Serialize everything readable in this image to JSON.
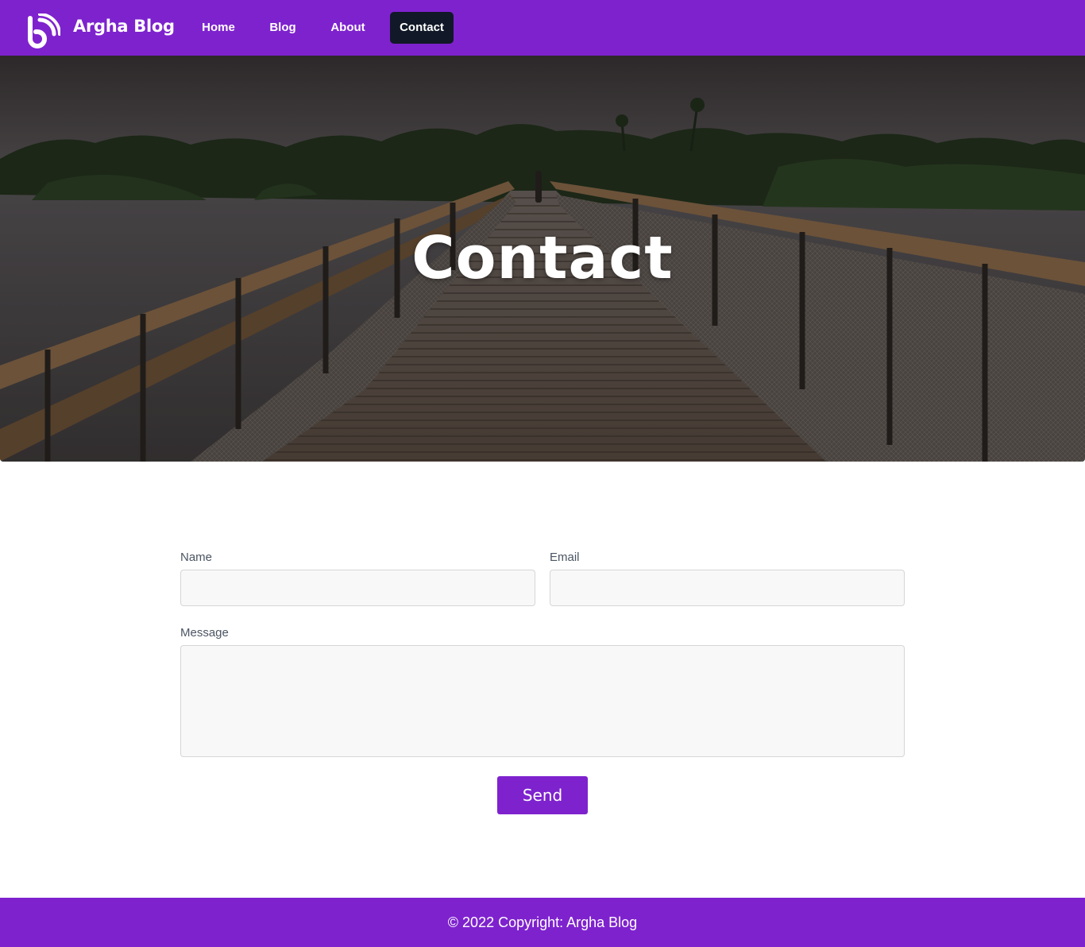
{
  "navbar": {
    "brand_name": "Argha Blog",
    "links": [
      {
        "label": "Home"
      },
      {
        "label": "Blog"
      },
      {
        "label": "About"
      },
      {
        "label": "Contact",
        "active": true
      }
    ],
    "background_color": "#7e22ce",
    "active_link_color": "#111827"
  },
  "hero": {
    "title": "Contact",
    "image": "bridge-boardwalk-photo"
  },
  "form": {
    "name_label": "Name",
    "name_value": "",
    "email_label": "Email",
    "email_value": "",
    "message_label": "Message",
    "message_value": "",
    "send_label": "Send"
  },
  "footer": {
    "text": "© 2022 Copyright: Argha Blog"
  }
}
